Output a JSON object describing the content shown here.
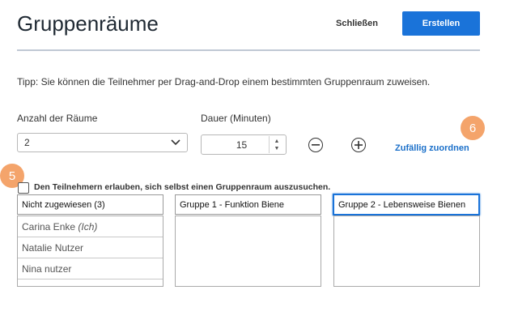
{
  "header": {
    "title": "Gruppenräume",
    "close_label": "Schließen",
    "create_label": "Erstellen"
  },
  "tip": "Tipp: Sie können die Teilnehmer per Drag-and-Drop einem bestimmten Gruppenraum zuweisen.",
  "rooms": {
    "label": "Anzahl der Räume",
    "value": "2"
  },
  "duration": {
    "label": "Dauer (Minuten)",
    "value": "15"
  },
  "random_label": "Zufällig zuordnen",
  "badges": {
    "six": "6",
    "five": "5"
  },
  "self_select": {
    "label": "Den Teilnehmern erlauben, sich selbst einen Gruppenraum auszusuchen.",
    "checked": false
  },
  "columns": [
    {
      "title": "Nicht zugewiesen (3)"
    },
    {
      "title": "Gruppe 1 - Funktion Biene"
    },
    {
      "title": "Gruppe 2 - Lebensweise Bienen"
    }
  ],
  "unassigned": [
    {
      "name": "Carina Enke",
      "suffix": "(Ich)"
    },
    {
      "name": "Natalie Nutzer"
    },
    {
      "name": "Nina nutzer"
    }
  ],
  "colors": {
    "accent": "#1a73d9",
    "badge": "#f4a46b",
    "link": "#1a6fc9"
  }
}
